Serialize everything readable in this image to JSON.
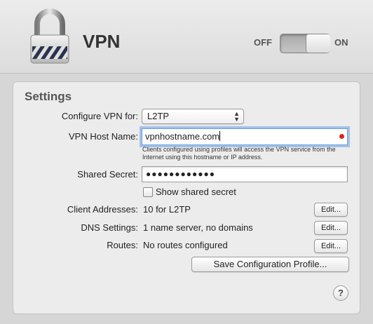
{
  "header": {
    "title": "VPN",
    "icon": "lock-icon",
    "switch": {
      "off_label": "OFF",
      "on_label": "ON",
      "state": "on"
    }
  },
  "settings": {
    "title": "Settings",
    "configure": {
      "label": "Configure VPN for:",
      "value": "L2TP"
    },
    "host": {
      "label": "VPN Host Name:",
      "value": "vpnhostname.com",
      "hint": "Clients configured using profiles will access the VPN service from the Internet using this hostname or IP address."
    },
    "secret": {
      "label": "Shared Secret:",
      "value": "●●●●●●●●●●●●"
    },
    "show_secret": {
      "label": "Show shared secret",
      "checked": false
    },
    "client_addresses": {
      "label": "Client Addresses:",
      "value": "10 for L2TP",
      "button": "Edit..."
    },
    "dns": {
      "label": "DNS Settings:",
      "value": "1 name server, no domains",
      "button": "Edit..."
    },
    "routes": {
      "label": "Routes:",
      "value": "No routes configured",
      "button": "Edit..."
    },
    "save_profile_button": "Save Configuration Profile...",
    "help": "?"
  }
}
